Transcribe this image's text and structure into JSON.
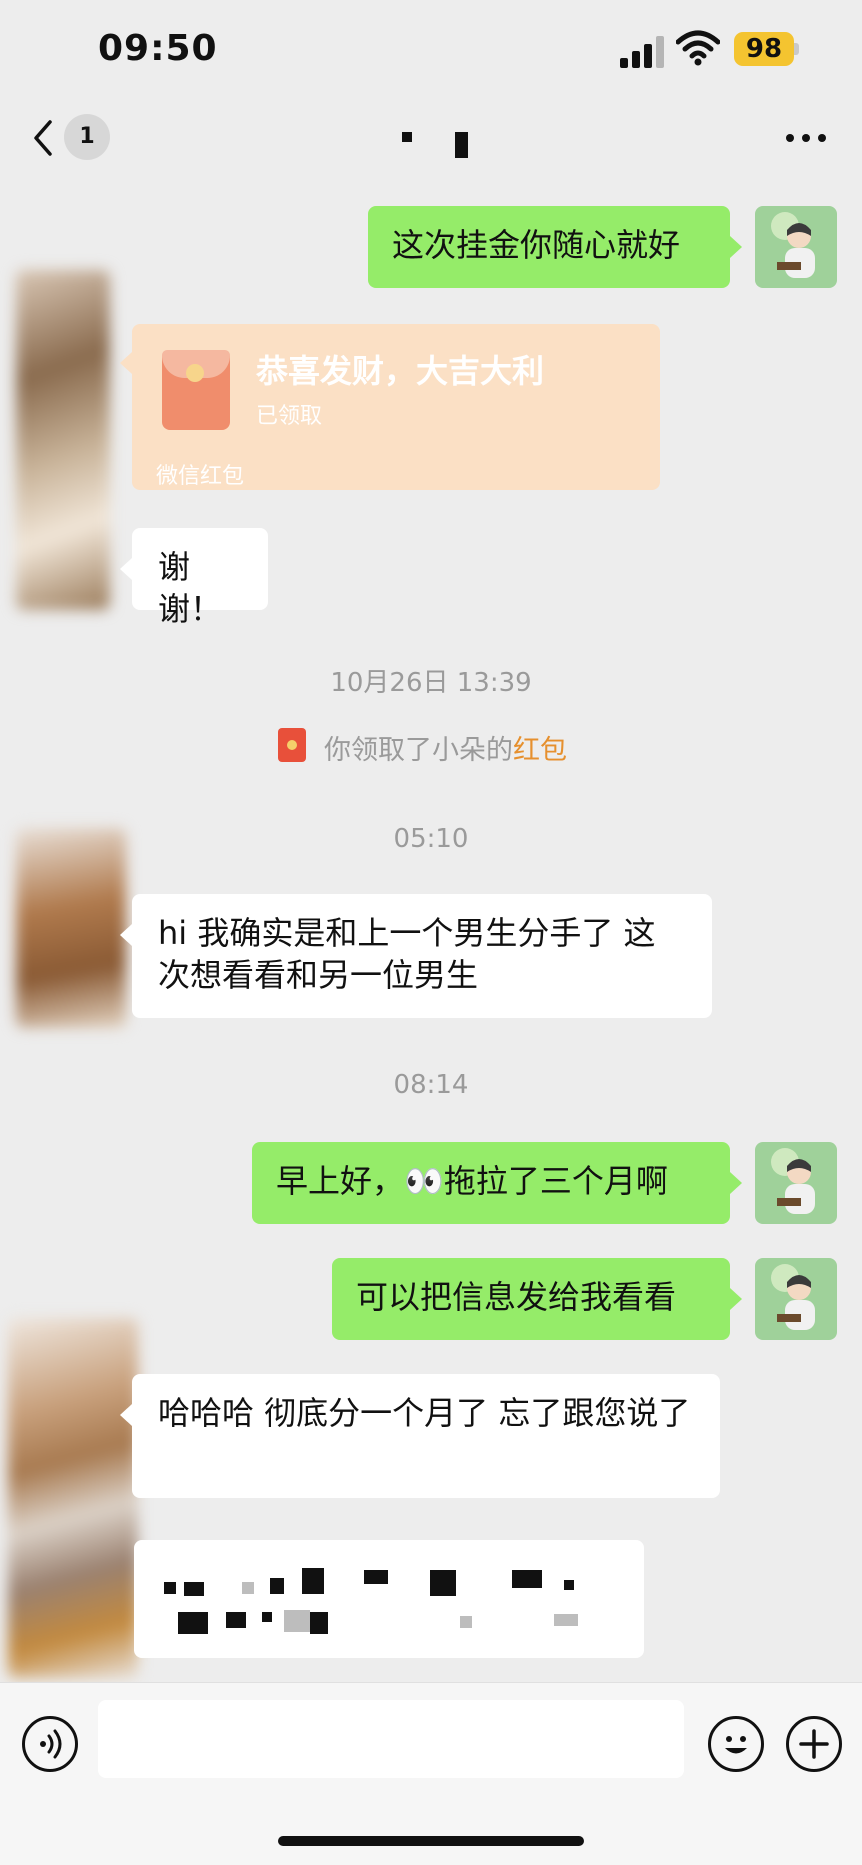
{
  "status_bar": {
    "time": "09:50",
    "battery": "98"
  },
  "nav": {
    "unread_count": "1"
  },
  "timestamps": {
    "t1": "10月26日 13:39",
    "t2": "05:10",
    "t3": "08:14"
  },
  "red_packet": {
    "title": "恭喜发财，大吉大利",
    "status": "已领取",
    "footer": "微信红包"
  },
  "system_message": {
    "prefix": "你领取了小朵的",
    "highlight": "红包"
  },
  "messages": [
    {
      "side": "right",
      "text": "这次挂金你随心就好"
    },
    {
      "side": "left",
      "text": "谢谢！"
    },
    {
      "side": "left",
      "text": "hi 我确实是和上一个男生分手了 这次想看看和另一位男生"
    },
    {
      "side": "right",
      "text": "早上好，👀拖拉了三个月啊"
    },
    {
      "side": "right",
      "text": "可以把信息发给我看看"
    },
    {
      "side": "left",
      "text": "哈哈哈 彻底分一个月了 忘了跟您说了"
    }
  ],
  "colors": {
    "self_bubble": "#95ec69",
    "other_bubble": "#ffffff",
    "background": "#ededed",
    "red_packet": "#fbe0c5",
    "highlight": "#e6902e"
  }
}
